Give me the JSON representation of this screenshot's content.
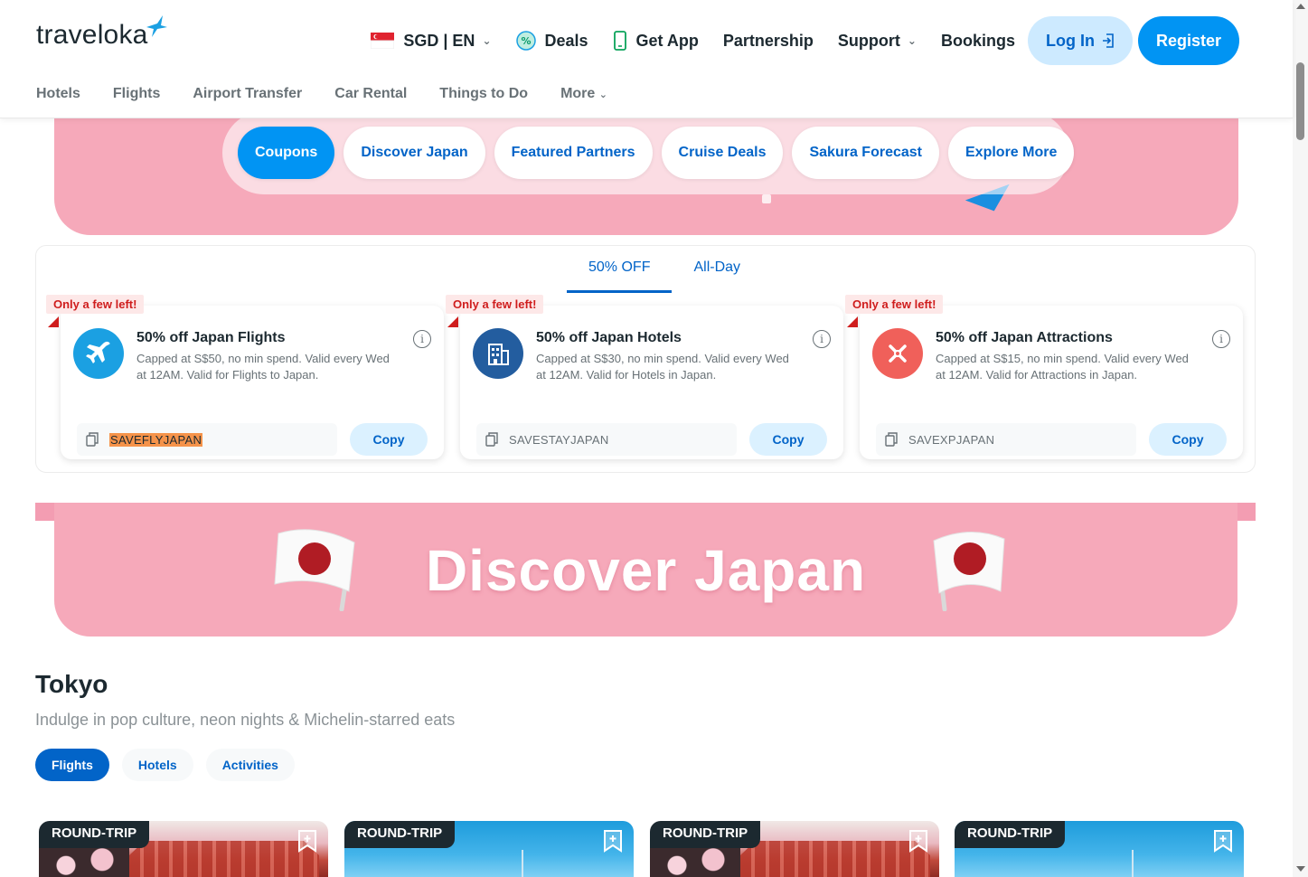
{
  "header": {
    "logo": "traveloka",
    "currency_lang": "SGD | EN",
    "nav": {
      "deals": "Deals",
      "get_app": "Get App",
      "partnership": "Partnership",
      "support": "Support",
      "bookings": "Bookings",
      "login": "Log In",
      "register": "Register"
    },
    "subnav": [
      "Hotels",
      "Flights",
      "Airport Transfer",
      "Car Rental",
      "Things to Do",
      "More"
    ]
  },
  "banner_tabs": [
    {
      "label": "Coupons",
      "active": true
    },
    {
      "label": "Discover Japan",
      "active": false
    },
    {
      "label": "Featured Partners",
      "active": false
    },
    {
      "label": "Cruise Deals",
      "active": false
    },
    {
      "label": "Sakura Forecast",
      "active": false
    },
    {
      "label": "Explore More",
      "active": false
    }
  ],
  "coupon_tabs": [
    {
      "label": "50% OFF",
      "active": true
    },
    {
      "label": "All-Day",
      "active": false
    }
  ],
  "coupons": [
    {
      "badge": "Only a few left!",
      "title": "50% off Japan Flights",
      "desc": "Capped at S$50, no min spend. Valid every Wed at 12AM. Valid for Flights to Japan.",
      "code": "SAVEFLYJAPAN",
      "copy": "Copy",
      "icon": "airplane-icon",
      "color": "#1ba0e2"
    },
    {
      "badge": "Only a few left!",
      "title": "50% off Japan Hotels",
      "desc": "Capped at S$30, no min spend. Valid every Wed at 12AM. Valid for Hotels in Japan.",
      "code": "SAVESTAYJAPAN",
      "copy": "Copy",
      "icon": "hotel-building-icon",
      "color": "#235d9f"
    },
    {
      "badge": "Only a few left!",
      "title": "50% off Japan Attractions",
      "desc": "Capped at S$15, no min spend. Valid every Wed at 12AM. Valid for Attractions in Japan.",
      "code": "SAVEXPJAPAN",
      "copy": "Copy",
      "icon": "attraction-icon",
      "color": "#f0605a"
    }
  ],
  "discover_banner": {
    "title": "Discover Japan"
  },
  "tokyo": {
    "title": "Tokyo",
    "subtitle": "Indulge in pop culture, neon nights & Michelin-starred eats",
    "tabs": [
      {
        "label": "Flights",
        "active": true
      },
      {
        "label": "Hotels",
        "active": false
      },
      {
        "label": "Activities",
        "active": false
      }
    ],
    "cards": [
      {
        "tag": "ROUND-TRIP",
        "image": "temple"
      },
      {
        "tag": "ROUND-TRIP",
        "image": "sky"
      },
      {
        "tag": "ROUND-TRIP",
        "image": "temple"
      },
      {
        "tag": "ROUND-TRIP",
        "image": "sky"
      }
    ]
  },
  "colors": {
    "brand_blue": "#0194f3",
    "dark_blue": "#0264c8",
    "banner_pink": "#f6a9ba",
    "highlight_orange": "#f5934a"
  }
}
